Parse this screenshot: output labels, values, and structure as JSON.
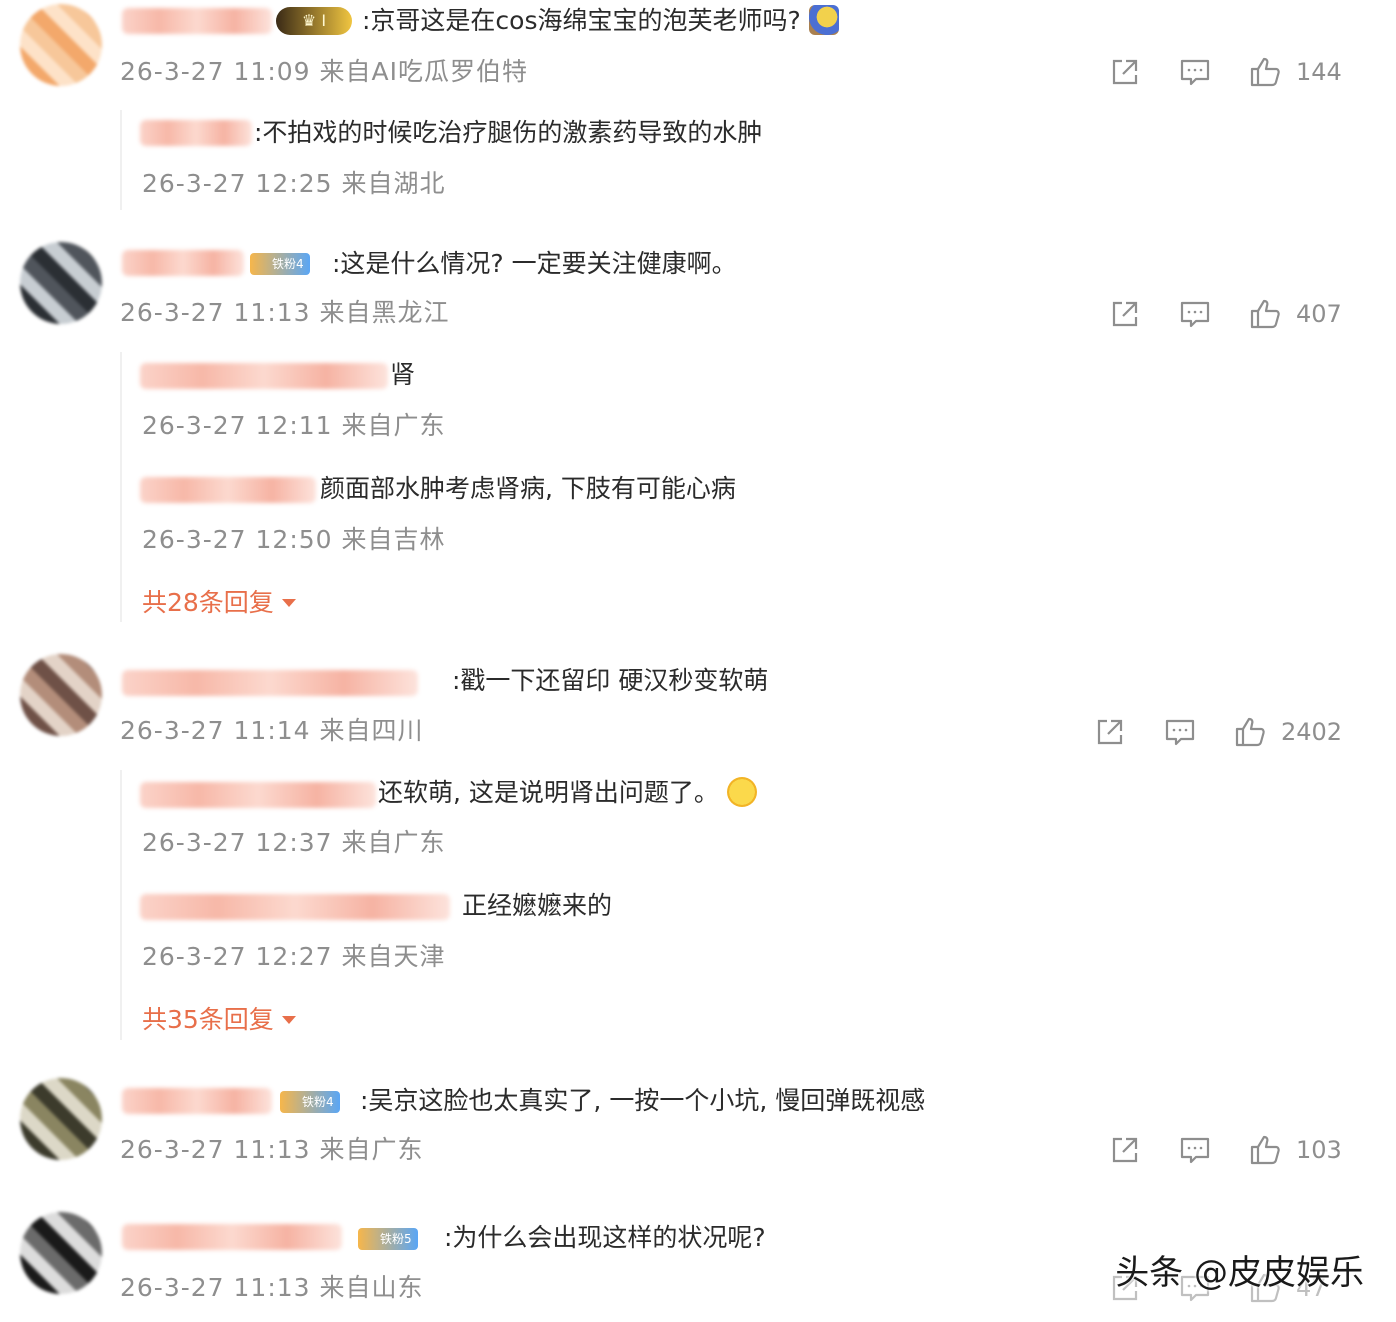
{
  "comments": [
    {
      "text": ":京哥这是在cos海绵宝宝的泡芙老师吗?",
      "crown_label": "I",
      "meta": "26-3-27 11:09 来自AI吃瓜罗伯特",
      "likes": "144",
      "replies": [
        {
          "text": ":不拍戏的时候吃治疗腿伤的激素药导致的水肿",
          "meta": "26-3-27 12:25 来自湖北"
        }
      ]
    },
    {
      "text": ":这是什么情况? 一定要关注健康啊。",
      "badge": "铁粉4",
      "meta": "26-3-27 11:13 来自黑龙江",
      "likes": "407",
      "replies": [
        {
          "text": "肾",
          "meta": "26-3-27 12:11 来自广东"
        },
        {
          "text": "颜面部水肿考虑肾病, 下肢有可能心病",
          "meta": "26-3-27 12:50 来自吉林"
        }
      ],
      "more": "共28条回复"
    },
    {
      "text": ":戳一下还留印 硬汉秒变软萌",
      "meta": "26-3-27 11:14 来自四川",
      "likes": "2402",
      "replies": [
        {
          "text": "还软萌, 这是说明肾出问题了。",
          "meta": "26-3-27 12:37 来自广东"
        },
        {
          "text": "正经嬷嬷来的",
          "meta": "26-3-27 12:27 来自天津"
        }
      ],
      "more": "共35条回复"
    },
    {
      "text": ":吴京这脸也太真实了, 一按一个小坑, 慢回弹既视感",
      "badge": "铁粉4",
      "meta": "26-3-27 11:13 来自广东",
      "likes": "103"
    },
    {
      "text": ":为什么会出现这样的状况呢?",
      "badge": "铁粉5",
      "meta": "26-3-27 11:13 来自山东",
      "likes": "47"
    }
  ],
  "icons": {
    "share": "share-icon",
    "comment": "comment-icon",
    "like": "thumbs-up-icon"
  },
  "watermark": "头条 @皮皮娱乐",
  "colors": {
    "more_link": "#e86f4a",
    "meta_text": "#8e8e8e",
    "body_text": "#2b2b2b"
  }
}
